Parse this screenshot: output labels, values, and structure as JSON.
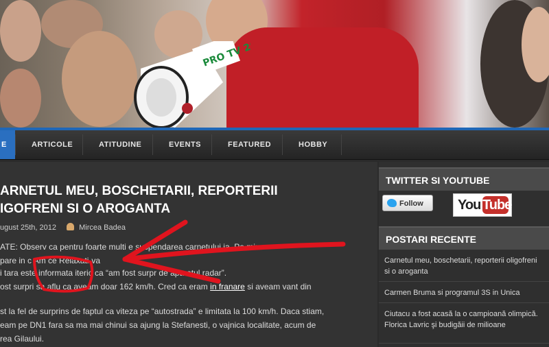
{
  "nav": {
    "home_label": "E",
    "items": [
      "ARTICOLE",
      "ATITUDINE",
      "EVENTS",
      "FEATURED",
      "HOBBY"
    ]
  },
  "post": {
    "title_line1": "ARNETUL MEU, BOSCHETARII, REPORTERII",
    "title_line2": "IGOFRENI SI O AROGANTA",
    "date": "ugust 25th, 2012",
    "author": "Mircea Badea",
    "lines": [
      "ATE: Observ ca pentru foarte multi            e suspendarea carnetului               ja. Pe mine",
      "pare in c    Am ce          Relaxati-va",
      "i tara este informata iteric ca “am fost surpr           de aparatul radar”.",
      "ost surpri     sa aflu ca aveam doar 162 km/h. Cred ca eram",
      "st la fel de surprins de faptul ca viteza pe “autostrada” e limitata la 100 km/h. Daca stiam,",
      "eam pe DN1 fara sa ma mai chinui sa ajung la Stefanesti, o vajnica localitate, acum de",
      "rea Gilaului."
    ],
    "link_text": "in franare",
    "line4_tail": "si aveam vant din"
  },
  "sidebar": {
    "twitter_heading": "TWITTER SI YOUTUBE",
    "follow_label": "Follow",
    "youtube_you": "You",
    "youtube_tube": "Tube",
    "recent_heading": "POSTARI RECENTE",
    "recent_posts": [
      "Carnetul meu, boschetarii, reporterii oligofreni si o aroganta",
      "Carmen Bruma si programul 3S in Unica",
      "Ciutacu a fost acasă la o campioană olimpică. Florica Lavric şi budigăii de milioane"
    ]
  },
  "banner": {
    "megaphone_text": "PRO TV 20"
  },
  "colors": {
    "accent_blue": "#1f67b7",
    "annotation_red": "#e0141e",
    "background": "#2b2b2b"
  }
}
